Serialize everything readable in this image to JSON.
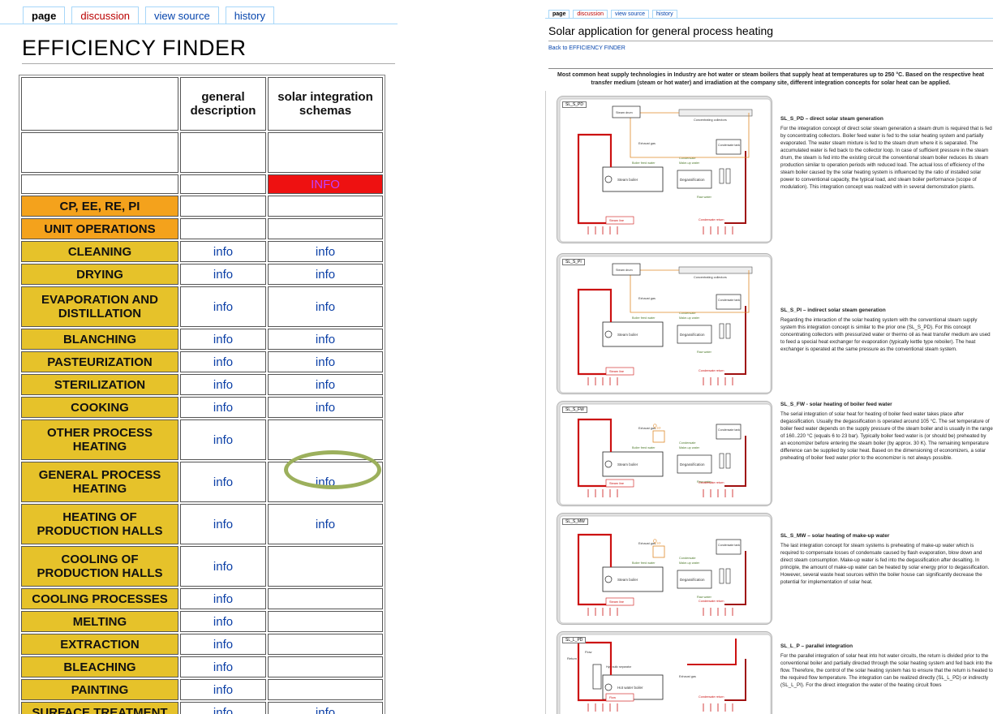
{
  "left": {
    "tabs": [
      {
        "label": "page"
      },
      {
        "label": "discussion"
      },
      {
        "label": "view source"
      },
      {
        "label": "history"
      }
    ],
    "title": "EFFICIENCY FINDER",
    "headers": {
      "col1": "general description",
      "col2": "solar integration schemas"
    },
    "red_cell": "INFO",
    "rows": [
      {
        "label": "CP, EE, RE, PI",
        "style": "orange",
        "c1": "",
        "c2": ""
      },
      {
        "label": "UNIT OPERATIONS",
        "style": "orange",
        "c1": "",
        "c2": ""
      },
      {
        "label": "CLEANING",
        "style": "yellow",
        "c1": "info",
        "c2": "info"
      },
      {
        "label": "DRYING",
        "style": "yellow",
        "c1": "info",
        "c2": "info"
      },
      {
        "label": "EVAPORATION AND DISTILLATION",
        "style": "yellow",
        "c1": "info",
        "c2": "info"
      },
      {
        "label": "BLANCHING",
        "style": "yellow",
        "c1": "info",
        "c2": "info"
      },
      {
        "label": "PASTEURIZATION",
        "style": "yellow",
        "c1": "info",
        "c2": "info"
      },
      {
        "label": "STERILIZATION",
        "style": "yellow",
        "c1": "info",
        "c2": "info"
      },
      {
        "label": "COOKING",
        "style": "yellow",
        "c1": "info",
        "c2": "info"
      },
      {
        "label": "OTHER PROCESS HEATING",
        "style": "yellow",
        "c1": "info",
        "c2": ""
      },
      {
        "label": "GENERAL PROCESS HEATING",
        "style": "yellow",
        "c1": "info",
        "c2": "info"
      },
      {
        "label": "HEATING OF PRODUCTION HALLS",
        "style": "yellow",
        "c1": "info",
        "c2": "info"
      },
      {
        "label": "COOLING OF PRODUCTION HALLS",
        "style": "yellow",
        "c1": "info",
        "c2": ""
      },
      {
        "label": "COOLING PROCESSES",
        "style": "yellow",
        "c1": "info",
        "c2": ""
      },
      {
        "label": "MELTING",
        "style": "yellow",
        "c1": "info",
        "c2": ""
      },
      {
        "label": "EXTRACTION",
        "style": "yellow",
        "c1": "info",
        "c2": ""
      },
      {
        "label": "BLEACHING",
        "style": "yellow",
        "c1": "info",
        "c2": ""
      },
      {
        "label": "PAINTING",
        "style": "yellow",
        "c1": "info",
        "c2": ""
      },
      {
        "label": "SURFACE TREATMENT",
        "style": "yellow",
        "c1": "info",
        "c2": "info"
      }
    ],
    "colors": {
      "orange": "#f4a21c",
      "yellow": "#e6c22a",
      "red": "#ee1111",
      "highlight": "#9cb05c",
      "link": "#0b3fa6"
    }
  },
  "right": {
    "tabs": [
      {
        "label": "page"
      },
      {
        "label": "discussion"
      },
      {
        "label": "view source"
      },
      {
        "label": "history"
      }
    ],
    "title": "Solar application for general process heating",
    "back_link": "Back to EFFICIENCY FINDER",
    "intro": "Most common heat supply technologies in Industry are hot water or steam boilers that supply heat at temperatures up to 250 °C. Based on the respective heat transfer medium (steam or hot water) and irradiation at the company site, different integration concepts for solar heat can be applied.",
    "schemes": [
      {
        "tag": "SL_S_PD",
        "title": "SL_S_PD – direct solar steam generation",
        "text": "For the integration concept of direct solar steam generation a steam drum is required that is fed by concentrating collectors. Boiler feed water is fed to the solar heating system and partially evaporated. The water steam mixture is fed to the steam drum where it is separated. The accumulated water is fed back to the collector loop. In case of sufficient pressure in the steam drum, the steam is fed into the existing circuit the conventional steam boiler reduces its steam production similar to operation periods with reduced load. The actual loss of efficiency of the steam boiler caused by the solar heating system is influenced by the ratio of installed solar power to conventional capacity, the typical load, and steam boiler performance (scope of modulation). This integration concept was realized with in several demonstration plants."
      },
      {
        "tag": "SL_S_PI",
        "title": "SL_S_PI – indirect solar steam generation",
        "text": "Regarding the interaction of the solar heating system with the conventional steam supply system this integration concept is similar to the prior one (SL_S_PD). For this concept concentrating collectors with pressurized water or thermo oil as heat transfer medium are used to feed a special heat exchanger for evaporation (typically kettle type reboiler). The heat exchanger is operated at the same pressure as the conventional steam system."
      },
      {
        "tag": "SL_S_FW",
        "title": "SL_S_FW - solar heating of boiler feed water",
        "text": "The serial integration of solar heat for heating of boiler feed water takes place after degassification. Usually the degassification is operated around 105 °C. The set temperature of boiler feed water depends on the supply pressure of the steam boiler and is usually in the range of 160..220 °C (equals 6 to 23 bar). Typically boiler feed water is (or should be) preheated by an economizer before entering the steam boiler (by approx. 30 K). The remaining temperature difference can be supplied by solar heat. Based on the dimensioning of economizers, a solar preheating of boiler feed water prior to the economizer is not always possible."
      },
      {
        "tag": "SL_S_MW",
        "title": "SL_S_MW – solar heating of make-up water",
        "text": "The last integration concept for steam systems is preheating of make-up water which is required to compensate losses of condensate caused by flash evaporation, blow down and direct steam consumption. Make-up water is fed into the degassification after desalting. In principle, the amount of make-up water can be heated by solar energy prior to degassification. However, several waste heat sources within the boiler house can significantly decrease the potential for implementation of solar heat."
      },
      {
        "tag": "SL_L_PD",
        "title": "SL_L_P – parallel integration",
        "text": "For the parallel integration of solar heat into hot water circuits, the return is divided prior to the conventional boiler and partially directed through the solar heating system and fed back into the flow. Therefore, the control of the solar heating system has to ensure that the return is heated to the required flow temperature. The integration can be realized directly (SL_L_PD) or indirectly (SL_L_PI). For the direct integration the water of the heating circuit flows"
      }
    ],
    "diagram_labels": {
      "steam_drum": "Steam drum",
      "collectors": "Concentrating collectors",
      "steam_boiler": "Steam boiler",
      "degassification": "Degassification",
      "condensate_tank": "Condensate tank",
      "exhaust_gas": "Exhaust gas",
      "boiler_feed_water": "Boiler feed water",
      "steam_line": "Steam line",
      "condensate_return": "Condensate return",
      "raw_water": "Raw water",
      "condensate": "Condensate",
      "makeup_water": "Make-up water",
      "hot_water_boiler": "Hot water boiler",
      "hydraulic_separator": "Hydraulic separator",
      "return": "Return",
      "flow": "Flow",
      "q_sol": "Q",
      "q_sol_sub": "sol"
    }
  }
}
